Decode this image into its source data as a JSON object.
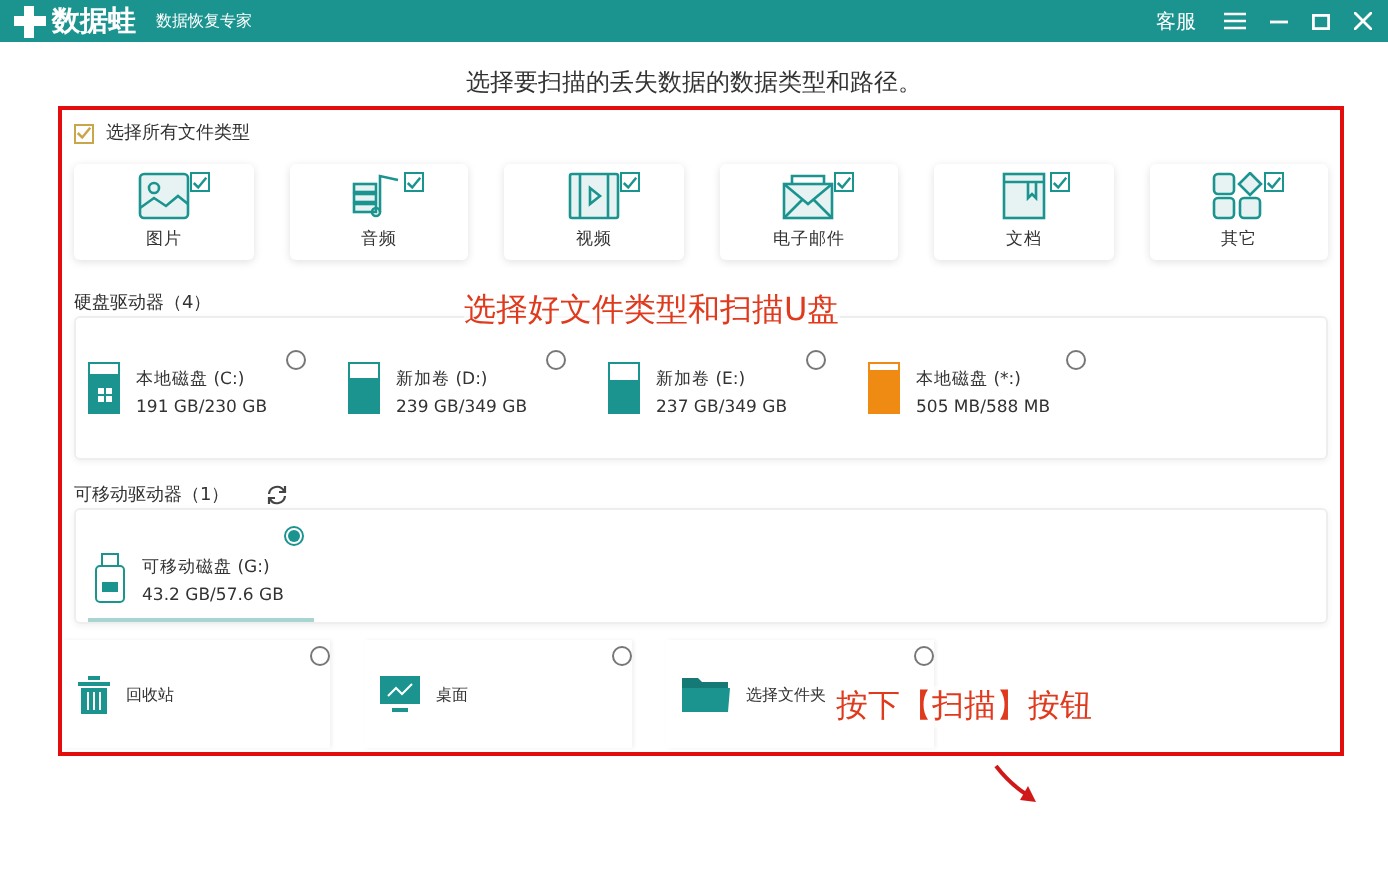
{
  "app": {
    "name": "数据蛙",
    "subtitle": "数据恢复专家",
    "service": "客服"
  },
  "instruction": "选择要扫描的丢失数据的数据类型和路径。",
  "select_all": {
    "label": "选择所有文件类型",
    "checked": true
  },
  "file_types": [
    {
      "kind": "image",
      "label": "图片",
      "checked": true
    },
    {
      "kind": "audio",
      "label": "音频",
      "checked": true
    },
    {
      "kind": "video",
      "label": "视频",
      "checked": true
    },
    {
      "kind": "email",
      "label": "电子邮件",
      "checked": true
    },
    {
      "kind": "document",
      "label": "文档",
      "checked": true
    },
    {
      "kind": "other",
      "label": "其它",
      "checked": true
    }
  ],
  "hard_drives": {
    "title": "硬盘驱动器（4）",
    "drives": [
      {
        "kind": "system",
        "name": "本地磁盘 (C:)",
        "size": "191 GB/230 GB",
        "level": 0.8,
        "color": "#1b948f",
        "selected": false
      },
      {
        "kind": "data",
        "name": "新加卷 (D:)",
        "size": "239 GB/349 GB",
        "level": 0.7,
        "color": "#1b948f",
        "selected": false
      },
      {
        "kind": "data",
        "name": "新加卷 (E:)",
        "size": "237 GB/349 GB",
        "level": 0.68,
        "color": "#1b948f",
        "selected": false
      },
      {
        "kind": "data",
        "name": "本地磁盘 (*:)",
        "size": "505 MB/588 MB",
        "level": 0.86,
        "color": "#ef8a12",
        "selected": false
      }
    ]
  },
  "removable": {
    "title": "可移动驱动器（1）",
    "drives": [
      {
        "name": "可移动磁盘 (G:)",
        "size": "43.2 GB/57.6 GB",
        "selected": true
      }
    ]
  },
  "locations": [
    {
      "kind": "recycle",
      "label": "回收站",
      "selected": false
    },
    {
      "kind": "desktop",
      "label": "桌面",
      "selected": false
    },
    {
      "kind": "folder",
      "label": "选择文件夹",
      "selected": false
    }
  ],
  "annotations": [
    {
      "kind": "top",
      "text": "选择好文件类型和扫描U盘"
    },
    {
      "kind": "bottom",
      "text": "按下【扫描】按钮"
    }
  ]
}
